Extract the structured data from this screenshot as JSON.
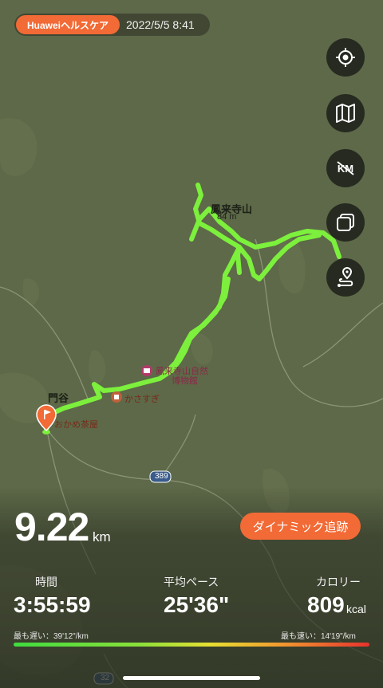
{
  "header": {
    "app_tag": "Huaweiヘルスケア",
    "datetime": "2022/5/5 8:41"
  },
  "side_buttons": [
    {
      "name": "locate-button",
      "icon": "crosshair-icon"
    },
    {
      "name": "map-style-button",
      "icon": "map-icon"
    },
    {
      "name": "km-marker-toggle",
      "icon": "km-icon"
    },
    {
      "name": "layers-button",
      "icon": "layers-icon"
    },
    {
      "name": "route-button",
      "icon": "route-pin-icon"
    }
  ],
  "map": {
    "labels": {
      "peak_name": "鳳来寺山",
      "peak_elev": "84 m",
      "museum_line1": "鳳来寺山自然",
      "museum_line2": "博物館",
      "kasasugi": "かさすぎ",
      "kadoya": "門谷",
      "okame": "おかめ茶屋",
      "route_389": "389",
      "route_32": "32"
    },
    "track_color": "#7cf03c"
  },
  "summary": {
    "distance": "9.22",
    "distance_unit": "km",
    "dynamic_button": "ダイナミック追跡",
    "stats": {
      "time_label": "時間",
      "time_value": "3:55:59",
      "pace_label": "平均ペース",
      "pace_value": "25'36\"",
      "calorie_label": "カロリー",
      "calorie_value": "809",
      "calorie_unit": "kcal"
    },
    "slowest": "最も遅い：39'12\"/km",
    "fastest": "最も速い：14'19\"/km"
  },
  "colors": {
    "accent": "#f26a35",
    "track": "#7cf03c",
    "button_bg": "#262a20"
  }
}
